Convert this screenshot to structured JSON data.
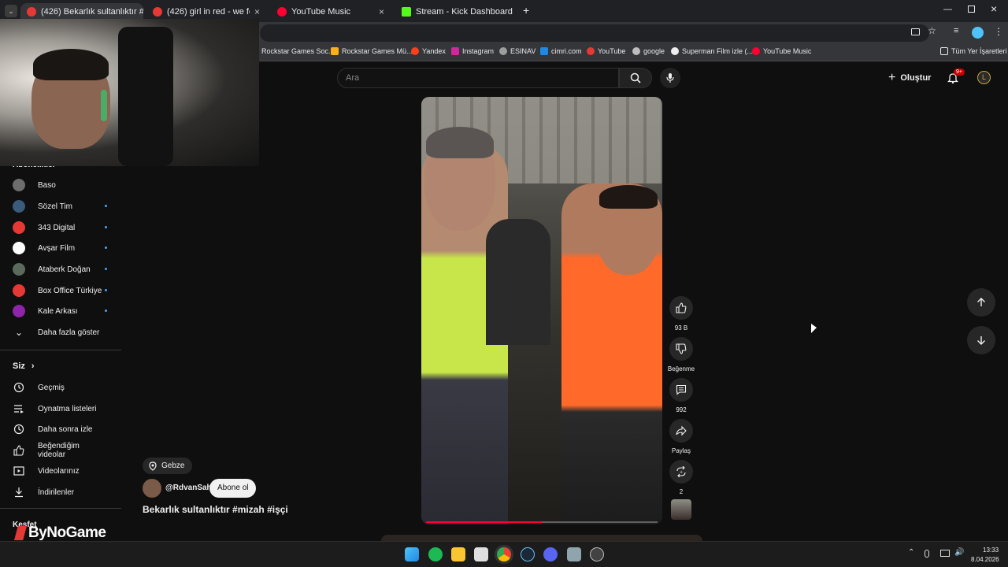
{
  "tabs": [
    {
      "title": "(426) Bekarlık sultanlıktır #r",
      "active": true
    },
    {
      "title": "(426) girl in red - we fell in love",
      "active": false
    },
    {
      "title": "YouTube Music",
      "active": false
    },
    {
      "title": "Stream - Kick Dashboard",
      "active": false
    }
  ],
  "bookmarks": [
    "Rockstar Games Soc...",
    "Rockstar Games Mü...",
    "Yandex",
    "Instagram",
    "ESINAV",
    "cimri.com",
    "YouTube",
    "google",
    "Superman Film izle (...",
    "YouTube Music"
  ],
  "all_bookmarks": "Tüm Yer İşaretleri",
  "search": {
    "placeholder": "Ara"
  },
  "create_label": "Oluştur",
  "notif_badge": "9+",
  "avatar_letter": "L",
  "subscriptions_heading": "Abonelikler",
  "subscriptions": [
    {
      "name": "Baso",
      "color": "#6d6d6d",
      "new": false
    },
    {
      "name": "Sözel Tim",
      "color": "#3b5b7a",
      "new": true
    },
    {
      "name": "343 Digital",
      "color": "#e53935",
      "new": true
    },
    {
      "name": "Avşar Film",
      "color": "#ffffff",
      "new": true
    },
    {
      "name": "Ataberk Doğan",
      "color": "#5a6b5c",
      "new": true
    },
    {
      "name": "Box Office Türkiye",
      "color": "#e53935",
      "new": true
    },
    {
      "name": "Kale Arkası",
      "color": "#8e24aa",
      "new": true
    }
  ],
  "show_more": "Daha fazla göster",
  "you_heading": "Siz",
  "you_items": [
    {
      "label": "Geçmiş",
      "icon": "history-icon"
    },
    {
      "label": "Oynatma listeleri",
      "icon": "playlist-icon"
    },
    {
      "label": "Daha sonra izle",
      "icon": "clock-icon"
    },
    {
      "label": "Beğendiğim videolar",
      "icon": "thumbs-up-icon"
    },
    {
      "label": "Videolarınız",
      "icon": "video-icon"
    },
    {
      "label": "İndirilenler",
      "icon": "download-icon"
    }
  ],
  "explore_heading": "Keşfet",
  "watermark": "ByNoGame",
  "short": {
    "location": "Gebze",
    "channel": "@RdvanSah",
    "subscribe": "Abone ol",
    "title": "Bekarlık sultanlıktır #mizah #işçi",
    "likes": "93 B",
    "dislike_label": "Beğenme",
    "comments": "992",
    "share_label": "Paylaş",
    "remix_count": "2",
    "progress": 0.5
  },
  "clock": {
    "time": "13:33",
    "date": "8.04.2026"
  }
}
